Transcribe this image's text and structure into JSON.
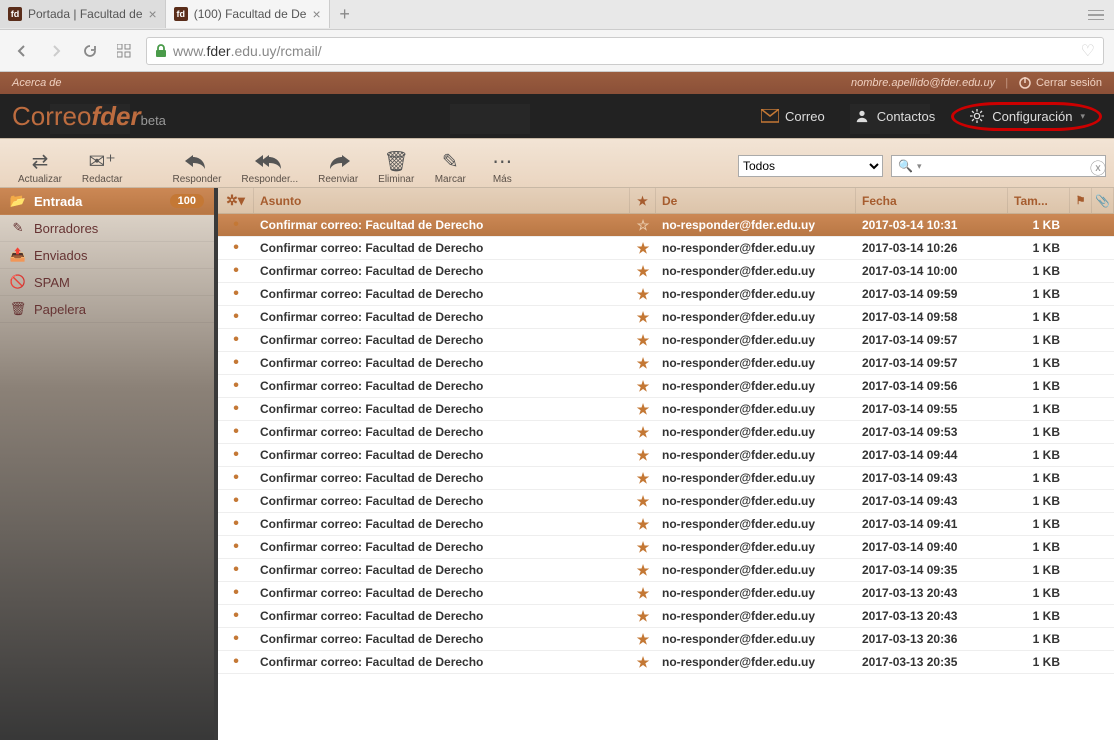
{
  "browser": {
    "tabs": [
      {
        "title": "Portada | Facultad de",
        "favicon": "fd",
        "active": false
      },
      {
        "title": "(100) Facultad de De",
        "favicon": "fd",
        "active": true
      }
    ],
    "url_prefix": "www.",
    "url_domain": "fder",
    "url_suffix": ".edu.uy/rcmail/"
  },
  "topbar": {
    "about": "Acerca de",
    "email": "nombre.apellido@fder.edu.uy",
    "logout": "Cerrar sesión"
  },
  "logo": {
    "correo": "Correo",
    "fder": "fder",
    "beta": "beta"
  },
  "nav": {
    "mail": "Correo",
    "contacts": "Contactos",
    "settings": "Configuración"
  },
  "toolbar": {
    "refresh": "Actualizar",
    "compose": "Redactar",
    "reply": "Responder",
    "replyall": "Responder...",
    "forward": "Reenviar",
    "delete": "Eliminar",
    "mark": "Marcar",
    "more": "Más",
    "filter": "Todos"
  },
  "folders": [
    {
      "name": "Entrada",
      "icon": "inbox",
      "count": "100",
      "active": true
    },
    {
      "name": "Borradores",
      "icon": "draft"
    },
    {
      "name": "Enviados",
      "icon": "sent"
    },
    {
      "name": "SPAM",
      "icon": "spam"
    },
    {
      "name": "Papelera",
      "icon": "trash"
    }
  ],
  "columns": {
    "subject": "Asunto",
    "from": "De",
    "date": "Fecha",
    "size": "Tam..."
  },
  "messages": [
    {
      "subject": "Confirmar correo: Facultad de Derecho",
      "from": "no-responder@fder.edu.uy",
      "date": "2017-03-14 10:31",
      "size": "1 KB",
      "selected": true,
      "starred": false,
      "unread": true
    },
    {
      "subject": "Confirmar correo: Facultad de Derecho",
      "from": "no-responder@fder.edu.uy",
      "date": "2017-03-14 10:26",
      "size": "1 KB",
      "starred": true,
      "unread": true
    },
    {
      "subject": "Confirmar correo: Facultad de Derecho",
      "from": "no-responder@fder.edu.uy",
      "date": "2017-03-14 10:00",
      "size": "1 KB",
      "starred": true,
      "unread": true
    },
    {
      "subject": "Confirmar correo: Facultad de Derecho",
      "from": "no-responder@fder.edu.uy",
      "date": "2017-03-14 09:59",
      "size": "1 KB",
      "starred": true,
      "unread": true
    },
    {
      "subject": "Confirmar correo: Facultad de Derecho",
      "from": "no-responder@fder.edu.uy",
      "date": "2017-03-14 09:58",
      "size": "1 KB",
      "starred": true,
      "unread": true
    },
    {
      "subject": "Confirmar correo: Facultad de Derecho",
      "from": "no-responder@fder.edu.uy",
      "date": "2017-03-14 09:57",
      "size": "1 KB",
      "starred": true,
      "unread": true
    },
    {
      "subject": "Confirmar correo: Facultad de Derecho",
      "from": "no-responder@fder.edu.uy",
      "date": "2017-03-14 09:57",
      "size": "1 KB",
      "starred": true,
      "unread": true
    },
    {
      "subject": "Confirmar correo: Facultad de Derecho",
      "from": "no-responder@fder.edu.uy",
      "date": "2017-03-14 09:56",
      "size": "1 KB",
      "starred": true,
      "unread": true
    },
    {
      "subject": "Confirmar correo: Facultad de Derecho",
      "from": "no-responder@fder.edu.uy",
      "date": "2017-03-14 09:55",
      "size": "1 KB",
      "starred": true,
      "unread": true
    },
    {
      "subject": "Confirmar correo: Facultad de Derecho",
      "from": "no-responder@fder.edu.uy",
      "date": "2017-03-14 09:53",
      "size": "1 KB",
      "starred": true,
      "unread": true
    },
    {
      "subject": "Confirmar correo: Facultad de Derecho",
      "from": "no-responder@fder.edu.uy",
      "date": "2017-03-14 09:44",
      "size": "1 KB",
      "starred": true,
      "unread": true
    },
    {
      "subject": "Confirmar correo: Facultad de Derecho",
      "from": "no-responder@fder.edu.uy",
      "date": "2017-03-14 09:43",
      "size": "1 KB",
      "starred": true,
      "unread": true
    },
    {
      "subject": "Confirmar correo: Facultad de Derecho",
      "from": "no-responder@fder.edu.uy",
      "date": "2017-03-14 09:43",
      "size": "1 KB",
      "starred": true,
      "unread": true
    },
    {
      "subject": "Confirmar correo: Facultad de Derecho",
      "from": "no-responder@fder.edu.uy",
      "date": "2017-03-14 09:41",
      "size": "1 KB",
      "starred": true,
      "unread": true
    },
    {
      "subject": "Confirmar correo: Facultad de Derecho",
      "from": "no-responder@fder.edu.uy",
      "date": "2017-03-14 09:40",
      "size": "1 KB",
      "starred": true,
      "unread": true
    },
    {
      "subject": "Confirmar correo: Facultad de Derecho",
      "from": "no-responder@fder.edu.uy",
      "date": "2017-03-14 09:35",
      "size": "1 KB",
      "starred": true,
      "unread": true
    },
    {
      "subject": "Confirmar correo: Facultad de Derecho",
      "from": "no-responder@fder.edu.uy",
      "date": "2017-03-13 20:43",
      "size": "1 KB",
      "starred": true,
      "unread": true
    },
    {
      "subject": "Confirmar correo: Facultad de Derecho",
      "from": "no-responder@fder.edu.uy",
      "date": "2017-03-13 20:43",
      "size": "1 KB",
      "starred": true,
      "unread": true
    },
    {
      "subject": "Confirmar correo: Facultad de Derecho",
      "from": "no-responder@fder.edu.uy",
      "date": "2017-03-13 20:36",
      "size": "1 KB",
      "starred": true,
      "unread": true
    },
    {
      "subject": "Confirmar correo: Facultad de Derecho",
      "from": "no-responder@fder.edu.uy",
      "date": "2017-03-13 20:35",
      "size": "1 KB",
      "starred": true,
      "unread": true
    }
  ]
}
